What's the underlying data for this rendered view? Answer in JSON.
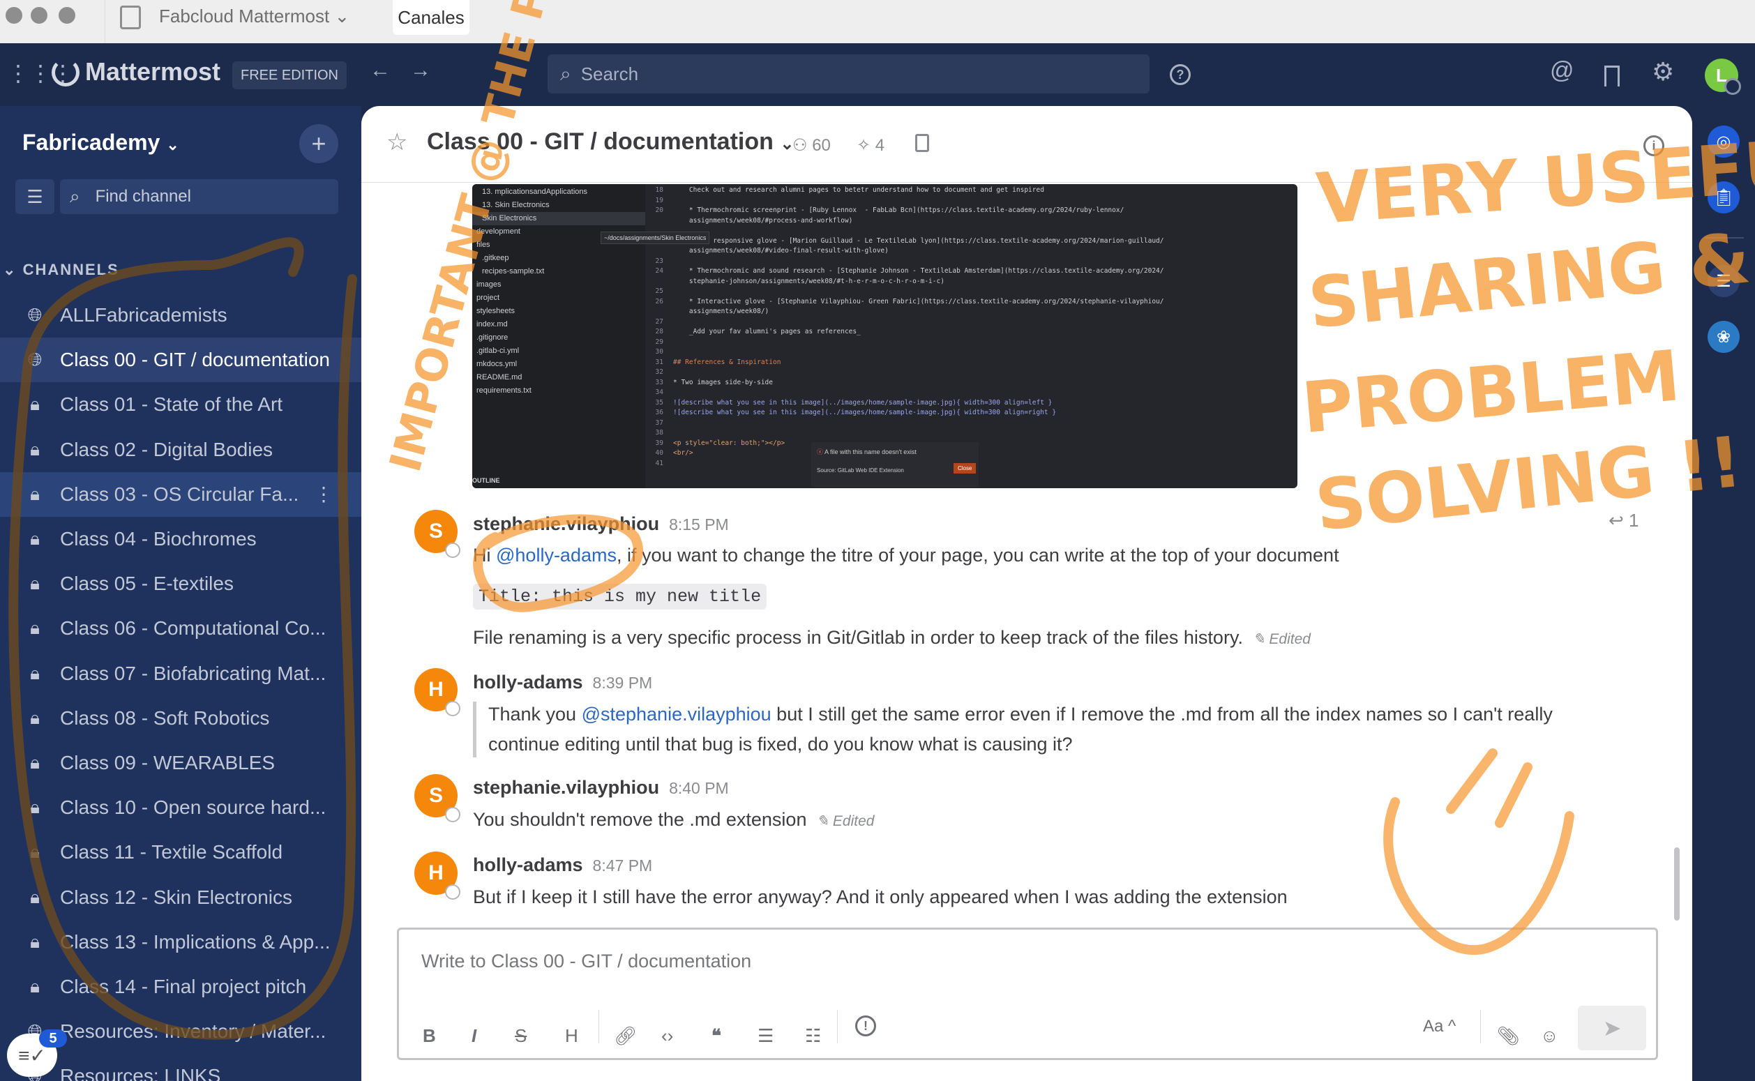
{
  "titlebar": {
    "server_name": "Fabcloud Mattermost",
    "tab": "Canales"
  },
  "topnav": {
    "product": "Mattermost",
    "edition_badge": "FREE EDITION",
    "search_placeholder": "Search",
    "avatar_initial": "L"
  },
  "sidebar": {
    "team_name": "Fabricademy",
    "find_channel_placeholder": "Find channel",
    "section_label": "CHANNELS",
    "unread_badge": "5",
    "channels": [
      {
        "label": "ALLFabricademists",
        "icon": "globe-icon"
      },
      {
        "label": "Class 00 - GIT / documentation",
        "icon": "globe-icon",
        "active": true
      },
      {
        "label": "Class 01 - State of the Art",
        "icon": "lock-icon"
      },
      {
        "label": "Class 02 - Digital Bodies",
        "icon": "lock-icon"
      },
      {
        "label": "Class 03 - OS Circular Fa...",
        "icon": "lock-icon",
        "hover": true
      },
      {
        "label": "Class 04 - Biochromes",
        "icon": "lock-icon"
      },
      {
        "label": "Class 05 - E-textiles",
        "icon": "lock-icon"
      },
      {
        "label": "Class 06 - Computational Co...",
        "icon": "lock-icon"
      },
      {
        "label": "Class 07 - Biofabricating Mat...",
        "icon": "lock-icon"
      },
      {
        "label": "Class 08 - Soft Robotics",
        "icon": "lock-icon"
      },
      {
        "label": "Class 09 - WEARABLES",
        "icon": "lock-icon"
      },
      {
        "label": "Class 10 - Open source hard...",
        "icon": "lock-icon"
      },
      {
        "label": "Class 11 - Textile Scaffold",
        "icon": "lock-icon"
      },
      {
        "label": "Class 12 - Skin Electronics",
        "icon": "lock-icon"
      },
      {
        "label": "Class 13 - Implications & App...",
        "icon": "lock-icon"
      },
      {
        "label": "Class 14 - Final project pitch",
        "icon": "lock-icon"
      },
      {
        "label": "Resources: Inventory / Mater...",
        "icon": "globe-icon"
      },
      {
        "label": "Resources: LINKS",
        "icon": "globe-icon"
      }
    ]
  },
  "channel_header": {
    "title": "Class 00 - GIT / documentation",
    "members": "60",
    "pinned": "4"
  },
  "screenshot": {
    "tree": [
      "13. mplicationsandApplications",
      "13. Skin Electronics",
      "Skin Electronics",
      "development",
      "files",
      ".gitkeep",
      "recipes-sample.txt",
      "images",
      "project",
      "stylesheets",
      "index.md",
      ".gitignore",
      ".gitlab-ci.yml",
      "mkdocs.yml",
      "README.md",
      "requirements.txt"
    ],
    "outline": "OUTLINE",
    "tooltip": "~/docs/assignments/Skin Electronics",
    "code": [
      {
        "n": "18",
        "t": "    Check out and research alumni pages to betetr understand how to document and get inspired"
      },
      {
        "n": "19",
        "t": ""
      },
      {
        "n": "20",
        "t": "    * Thermochromic screenprint - [Ruby Lennox  - FabLab Bcn](https://class.textile-academy.org/2024/ruby-lennox/"
      },
      {
        "n": "",
        "t": "    assignments/week08/#process-and-workflow)"
      },
      {
        "n": "",
        "t": ""
      },
      {
        "n": "22",
        "t": "    * Led responsive glove - [Marion Guillaud - Le TextileLab lyon](https://class.textile-academy.org/2024/marion-guillaud/"
      },
      {
        "n": "",
        "t": "    assignments/week08/#video-final-result-with-glove)"
      },
      {
        "n": "23",
        "t": ""
      },
      {
        "n": "24",
        "t": "    * Thermochromic and sound research - [Stephanie Johnson - TextileLab Amsterdam](https://class.textile-academy.org/2024/"
      },
      {
        "n": "",
        "t": "    stephanie-johnson/assignments/week08/#t-h-e-r-m-o-c-h-r-o-m-i-c)"
      },
      {
        "n": "25",
        "t": ""
      },
      {
        "n": "26",
        "t": "    * Interactive glove - [Stephanie Vilayphiou- Green Fabric](https://class.textile-academy.org/2024/stephanie-vilayphiou/"
      },
      {
        "n": "",
        "t": "    assignments/week08/)"
      },
      {
        "n": "27",
        "t": ""
      },
      {
        "n": "28",
        "t": "    _Add your fav alumni's pages as references_"
      },
      {
        "n": "29",
        "t": ""
      },
      {
        "n": "30",
        "t": ""
      },
      {
        "n": "31",
        "t": "## References & Inspiration",
        "c": "#e3804a"
      },
      {
        "n": "32",
        "t": ""
      },
      {
        "n": "33",
        "t": "* Two images side-by-side"
      },
      {
        "n": "34",
        "t": ""
      },
      {
        "n": "35",
        "t": "![describe what you see in this image](../images/home/sample-image.jpg){ width=300 align=left }",
        "c": "#9aa6f0"
      },
      {
        "n": "36",
        "t": "![describe what you see in this image](../images/home/sample-image.jpg){ width=300 align=right }",
        "c": "#9aa6f0"
      },
      {
        "n": "37",
        "t": ""
      },
      {
        "n": "38",
        "t": ""
      },
      {
        "n": "39",
        "t": "<p style=\"clear: both;\"></p>",
        "c": "#e3a06a"
      },
      {
        "n": "40",
        "t": "<br/>",
        "c": "#e3a06a"
      },
      {
        "n": "41",
        "t": ""
      }
    ],
    "notification": {
      "message": "A file with this name doesn't exist",
      "source": "Source: GitLab Web IDE Extension",
      "close": "Close"
    }
  },
  "posts": [
    {
      "author": "stephanie.vilayphiou",
      "initial": "S",
      "time": "8:15 PM",
      "pre": "Hi ",
      "mention": "@holly-adams",
      "post": ", if you want to change the titre of your page, you can write at the top of your document",
      "code": "Title: this is my new title",
      "line2": "File renaming is a very specific process in Git/Gitlab in order to keep track of the files history.",
      "edited": "Edited",
      "reply_count": "1"
    },
    {
      "author": "holly-adams",
      "initial": "H",
      "time": "8:39 PM",
      "pre": "Thank you ",
      "mention": "@stephanie.vilayphiou",
      "post": " but I still get the same error even if I remove the .md from all the index names so I can't really",
      "line2": "continue editing until that bug is fixed, do you know what is causing it?"
    },
    {
      "author": "stephanie.vilayphiou",
      "initial": "S",
      "time": "8:40 PM",
      "text": "You shouldn't remove the .md extension",
      "edited": "Edited"
    },
    {
      "author": "holly-adams",
      "initial": "H",
      "time": "8:47 PM",
      "text": "But if I keep it I still have the error anyway? And it only appeared when I was adding the extension"
    }
  ],
  "composer": {
    "placeholder": "Write to Class 00 - GIT / documentation",
    "format_label": "Aa ^"
  },
  "annotations": {
    "left_note": "IMPORTANT @ THE PEOPLE",
    "right_note_1": "VERY USEFUL",
    "right_note_2": "SHARING &",
    "right_note_3": "PROBLEM",
    "right_note_4": "SOLVING !!",
    "color": "#f7962d"
  },
  "colors": {
    "nav_bg": "#1c2a4c",
    "sidebar_bg": "#1f325e",
    "mention": "#2a67c6",
    "avatar": "#f5870b",
    "user_avatar": "#7ac943"
  }
}
